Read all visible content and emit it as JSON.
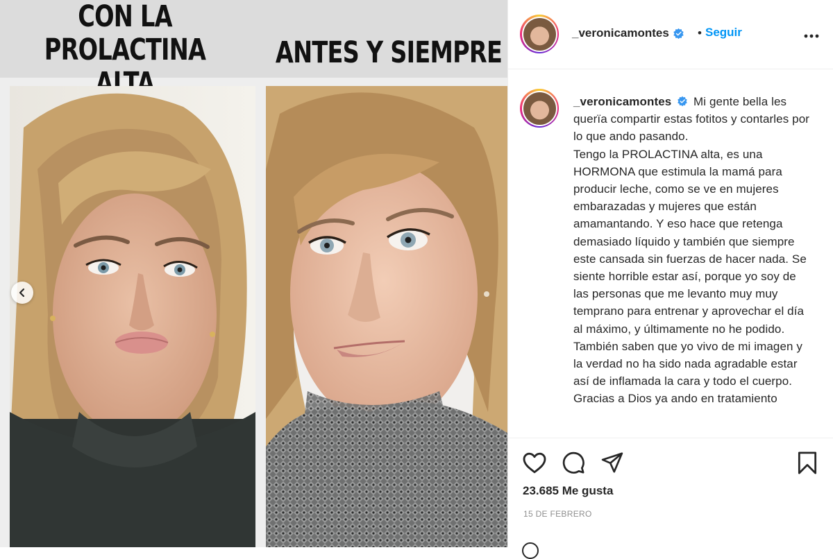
{
  "image": {
    "left_caption_lines": [
      "CON LA PROLACTINA",
      "ALTA"
    ],
    "right_caption": "ANTES Y SIEMPRE",
    "carousel_prev_icon": "chevron-left-icon"
  },
  "post": {
    "username": "_veronicamontes",
    "verified": true,
    "follow_label": "Seguir",
    "separator": "•",
    "more_icon": "more-options-icon",
    "caption": "Mi gente bella les querïa compartir estas fotitos y contarles por lo que ando pasando.\nTengo la PROLACTINA alta, es una HORMONA que estimula la mamá para producir leche, como se ve en mujeres embarazadas y mujeres que están amamantando. Y eso hace que retenga demasiado líquido y también que siempre este cansada sin fuerzas de hacer nada. Se siente horrible estar así, porque yo soy de las personas que me levanto muy muy temprano para entrenar y aprovechar el día al máximo, y últimamente no he podido.\nTambién saben que yo vivo de mi imagen y la verdad no ha sido nada agradable estar así de inflamada la cara y todo el cuerpo.\nGracias a Dios ya ando en tratamiento",
    "likes": "23.685 Me gusta",
    "date": "15 DE FEBRERO"
  },
  "colors": {
    "link_blue": "#0095f6",
    "verified_blue": "#3897f0",
    "text": "#262626",
    "muted": "#8e8e8e"
  }
}
